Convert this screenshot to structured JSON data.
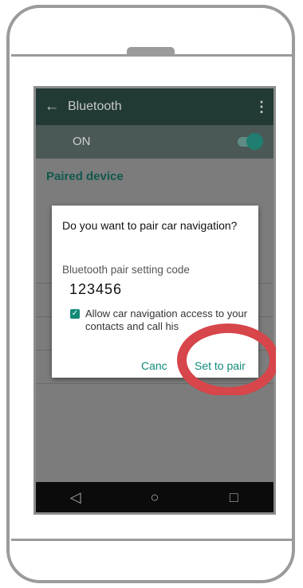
{
  "header": {
    "title": "Bluetooth",
    "back_icon": "arrow-left-icon",
    "menu_icon": "kebab-menu-icon"
  },
  "toggle_row": {
    "label": "ON",
    "state": "on"
  },
  "section": {
    "paired_title": "Paired device"
  },
  "dialog": {
    "title": "Do you want to pair car navigation?",
    "code_label": "Bluetooth pair setting code",
    "code": "123456",
    "checkbox_checked": true,
    "checkbox_text": "Allow car navigation access to your contacts and call his",
    "cancel_label": "Canc",
    "confirm_label": "Set to pair"
  },
  "navbar": {
    "back": "◁",
    "home": "○",
    "recents": "□"
  },
  "colors": {
    "accent": "#0f8a78",
    "annotation": "#d6464a"
  }
}
